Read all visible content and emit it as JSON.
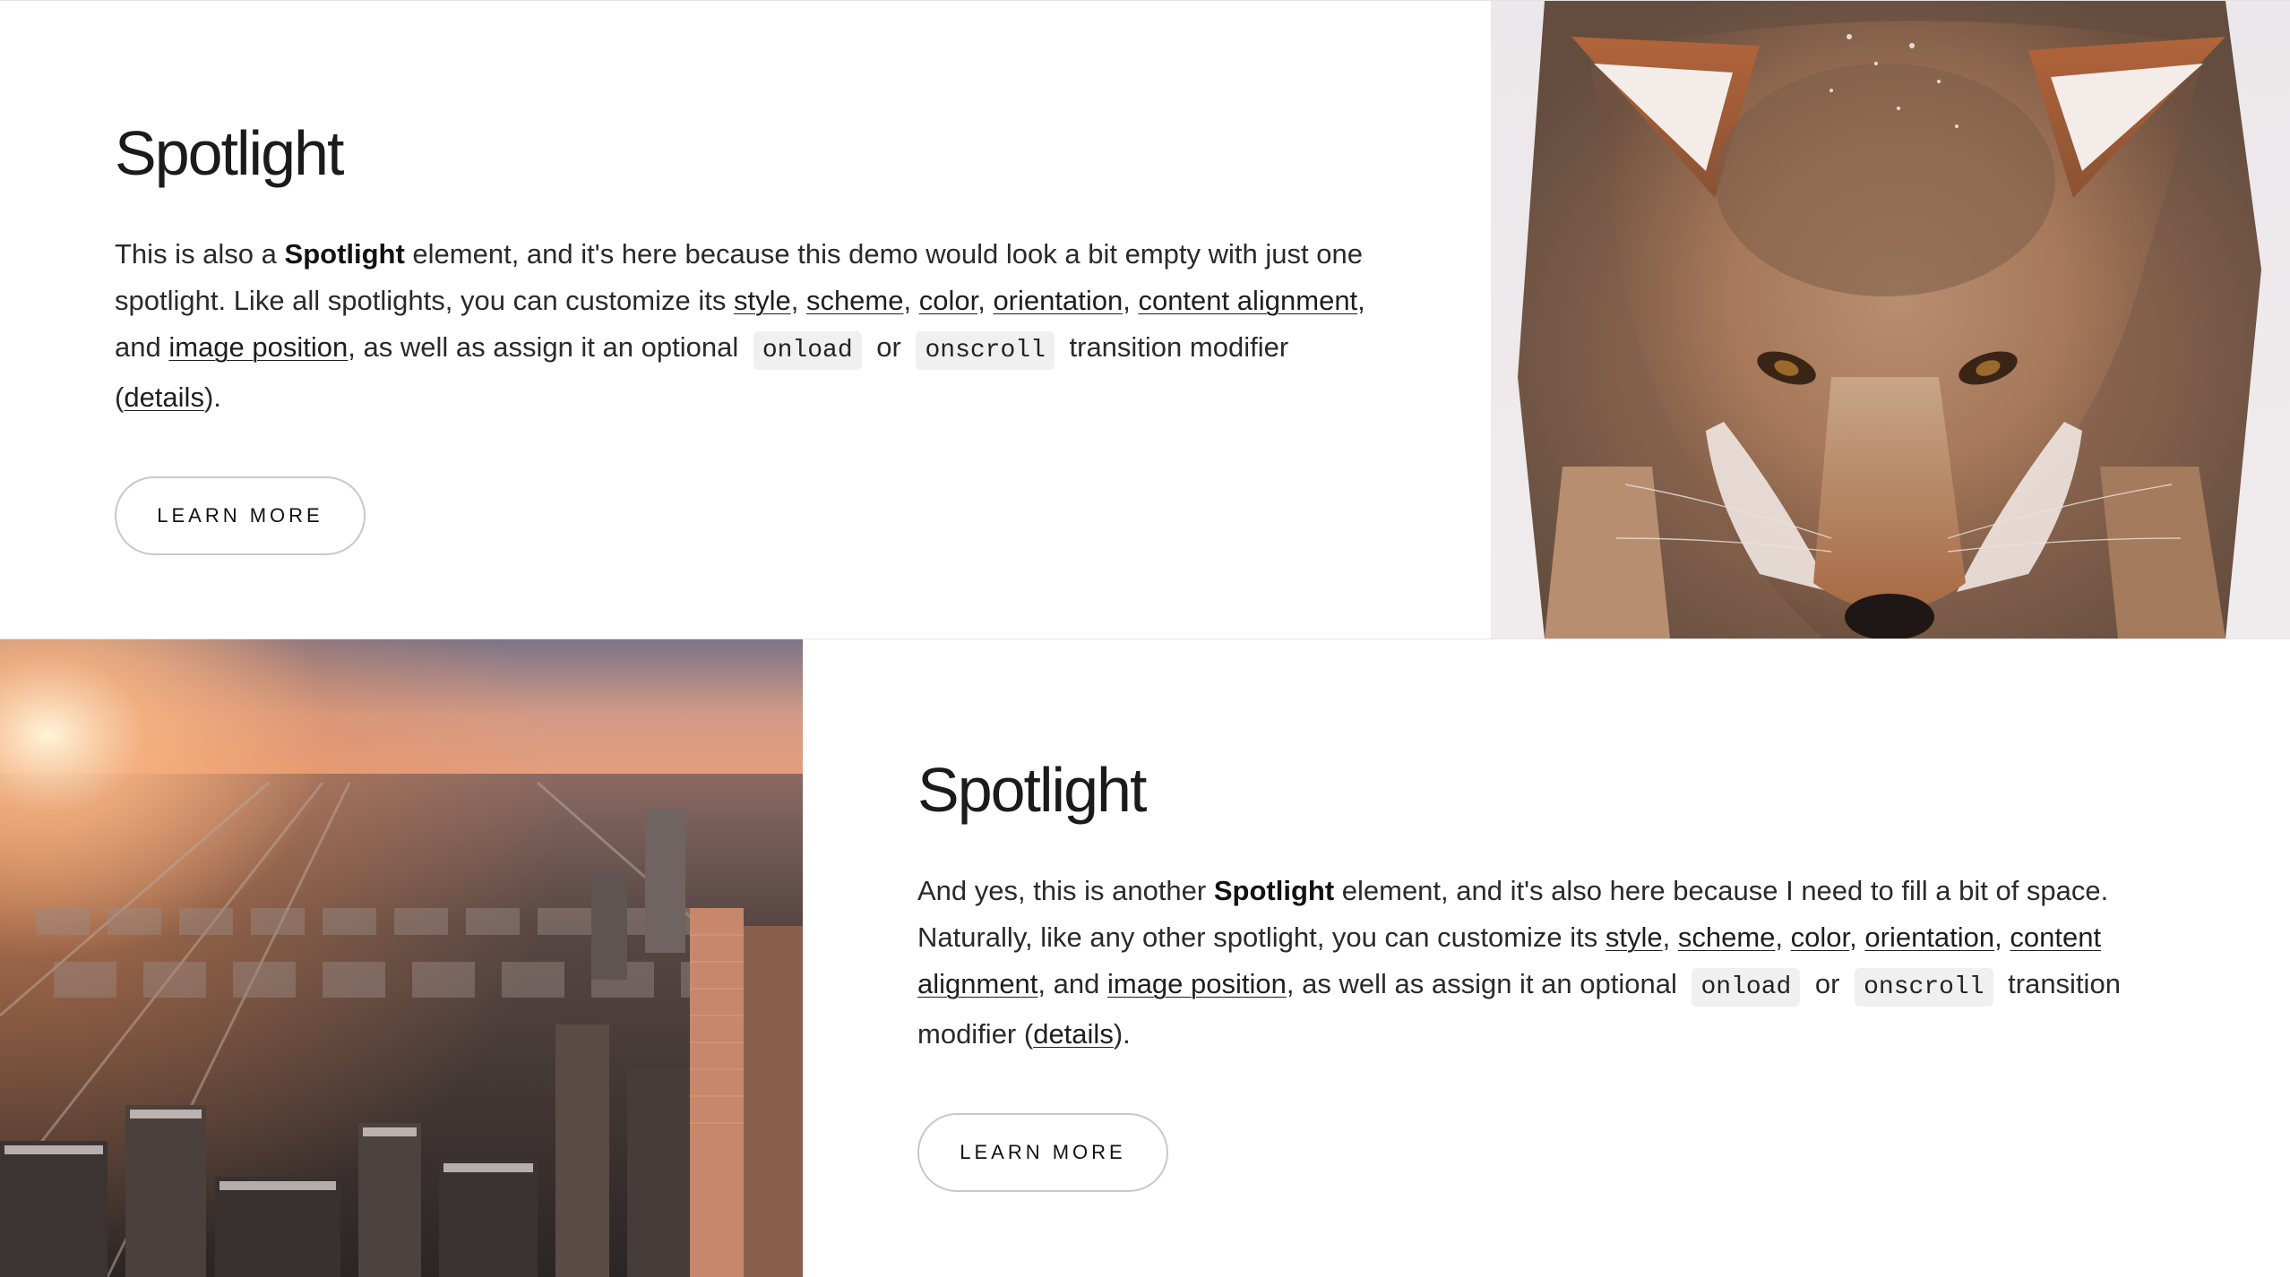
{
  "spotlights": [
    {
      "title": "Spotlight",
      "desc": {
        "p1": "This is also a ",
        "strong": "Spotlight",
        "p2": " element, and it's here because this demo would look a bit empty with just one spotlight. Like all spotlights, you can customize its ",
        "link_style": "style",
        "sep1": ", ",
        "link_scheme": "scheme",
        "sep2": ", ",
        "link_color": "color",
        "sep3": ", ",
        "link_orientation": "orientation",
        "sep4": ", ",
        "link_content_alignment": "content alignment",
        "sep5": ", and ",
        "link_image_position": "image position",
        "p3": ", as well as assign it an optional ",
        "code_onload": "onload",
        "or": " or ",
        "code_onscroll": "onscroll",
        "p4": " transition modifier (",
        "link_details": "details",
        "p5": ")."
      },
      "button_label": "LEARN MORE",
      "image": "coyote-in-snow-photo"
    },
    {
      "title": "Spotlight",
      "desc": {
        "p1": "And yes, this is another ",
        "strong": "Spotlight",
        "p2": " element, and it's also here because I need to fill a bit of space. Naturally, like any other spotlight, you can customize its ",
        "link_style": "style",
        "sep1": ", ",
        "link_scheme": "scheme",
        "sep2": ", ",
        "link_color": "color",
        "sep3": ", ",
        "link_orientation": "orientation",
        "sep4": ", ",
        "link_content_alignment": "content alignment",
        "sep5": ", and ",
        "link_image_position": "image position",
        "p3": ", as well as assign it an optional ",
        "code_onload": "onload",
        "or": " or ",
        "code_onscroll": "onscroll",
        "p4": " transition modifier (",
        "link_details": "details",
        "p5": ")."
      },
      "button_label": "LEARN MORE",
      "image": "city-aerial-sunset-photo"
    }
  ],
  "colors": {
    "background": "#ffffff",
    "text": "#212121",
    "button_border": "#c8c8c8",
    "code_background": "#f0f0f0"
  }
}
